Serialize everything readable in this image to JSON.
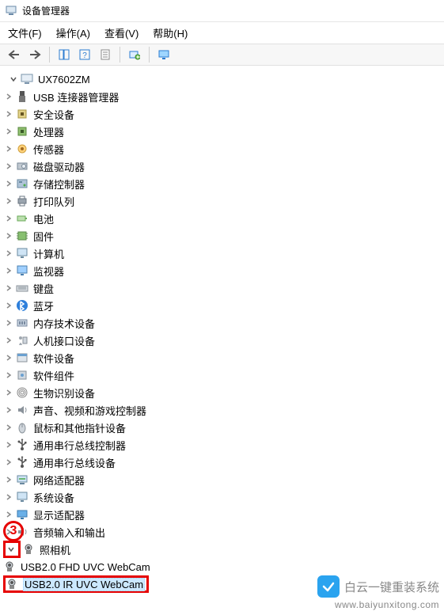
{
  "window": {
    "title": "设备管理器"
  },
  "menu": {
    "file": "文件(F)",
    "action": "操作(A)",
    "view": "查看(V)",
    "help": "帮助(H)"
  },
  "tree": {
    "root": {
      "label": "UX7602ZM",
      "expanded": true
    },
    "categories": [
      {
        "id": "usb-connector",
        "label": "USB 连接器管理器",
        "icon": "usb-plug"
      },
      {
        "id": "security-devices",
        "label": "安全设备",
        "icon": "chip"
      },
      {
        "id": "processors",
        "label": "处理器",
        "icon": "cpu"
      },
      {
        "id": "sensors",
        "label": "传感器",
        "icon": "sensor"
      },
      {
        "id": "disk-drives",
        "label": "磁盘驱动器",
        "icon": "disk"
      },
      {
        "id": "storage-controllers",
        "label": "存储控制器",
        "icon": "storage"
      },
      {
        "id": "print-queues",
        "label": "打印队列",
        "icon": "printer"
      },
      {
        "id": "batteries",
        "label": "电池",
        "icon": "battery"
      },
      {
        "id": "firmware",
        "label": "固件",
        "icon": "chip-green"
      },
      {
        "id": "computer",
        "label": "计算机",
        "icon": "computer"
      },
      {
        "id": "monitors",
        "label": "监视器",
        "icon": "monitor"
      },
      {
        "id": "keyboards",
        "label": "键盘",
        "icon": "keyboard"
      },
      {
        "id": "bluetooth",
        "label": "蓝牙",
        "icon": "bluetooth"
      },
      {
        "id": "memory-tech",
        "label": "内存技术设备",
        "icon": "memory"
      },
      {
        "id": "hid",
        "label": "人机接口设备",
        "icon": "hid"
      },
      {
        "id": "software-devices",
        "label": "软件设备",
        "icon": "software"
      },
      {
        "id": "software-components",
        "label": "软件组件",
        "icon": "component"
      },
      {
        "id": "biometric",
        "label": "生物识别设备",
        "icon": "fingerprint"
      },
      {
        "id": "audio-video-game",
        "label": "声音、视频和游戏控制器",
        "icon": "speaker"
      },
      {
        "id": "mice",
        "label": "鼠标和其他指针设备",
        "icon": "mouse"
      },
      {
        "id": "usb-controllers",
        "label": "通用串行总线控制器",
        "icon": "usb"
      },
      {
        "id": "usb-devices",
        "label": "通用串行总线设备",
        "icon": "usb"
      },
      {
        "id": "network-adapters",
        "label": "网络适配器",
        "icon": "network"
      },
      {
        "id": "system-devices",
        "label": "系统设备",
        "icon": "system"
      },
      {
        "id": "display-adapters",
        "label": "显示适配器",
        "icon": "display"
      },
      {
        "id": "audio-io",
        "label": "音频输入和输出",
        "icon": "speaker"
      },
      {
        "id": "cameras",
        "label": "照相机",
        "icon": "camera",
        "expanded": true,
        "children": [
          {
            "id": "cam-fhd",
            "label": "USB2.0 FHD UVC WebCam",
            "icon": "camera"
          },
          {
            "id": "cam-ir",
            "label": "USB2.0 IR UVC WebCam",
            "icon": "camera",
            "selected": true
          }
        ]
      }
    ]
  },
  "annotation": {
    "step_number": "3"
  },
  "watermark": {
    "brand": "白云一键重装系统",
    "url": "www.baiyunxitong.com"
  }
}
